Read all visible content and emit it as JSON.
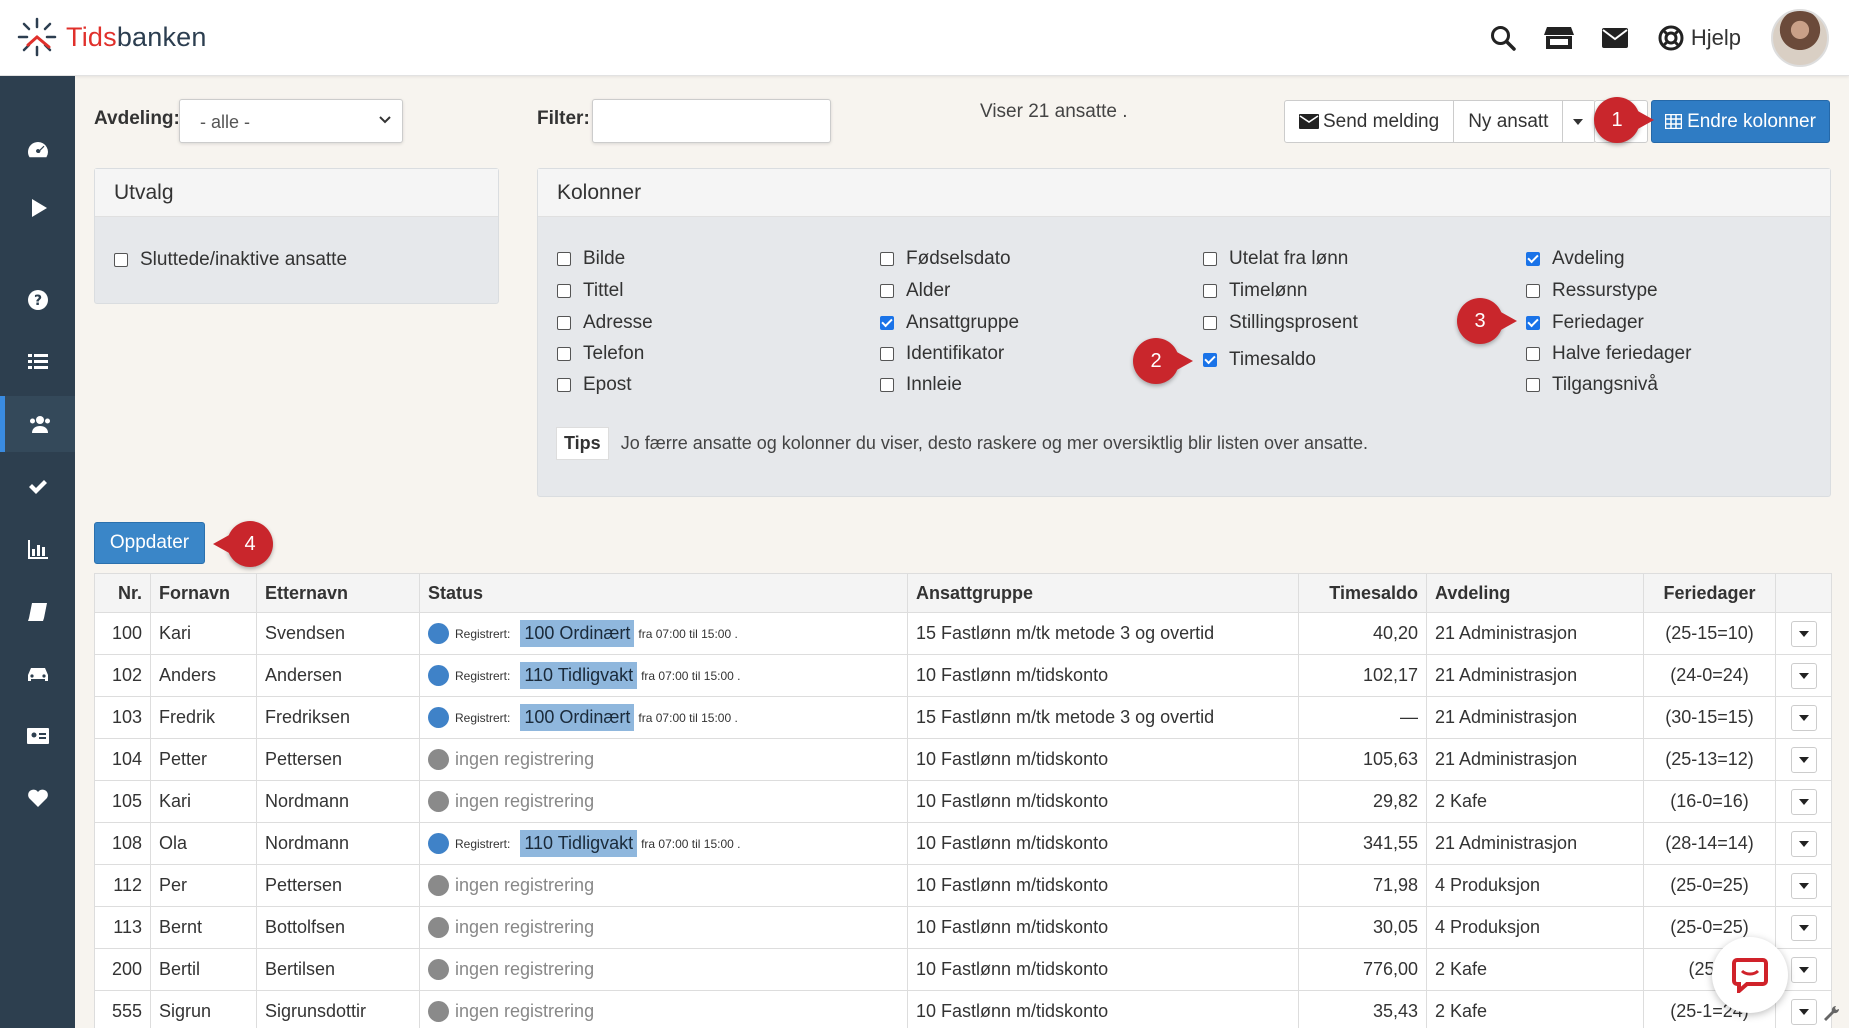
{
  "app": {
    "brand_first": "Tids",
    "brand_second": "banken"
  },
  "header": {
    "help_label": "Hjelp",
    "icons": [
      "search-icon",
      "store-icon",
      "envelope-icon",
      "lifebuoy-icon"
    ]
  },
  "sidebar": {
    "icons": [
      "dashboard-icon",
      "play-icon",
      "question-icon",
      "list-icon",
      "users-icon",
      "check-icon",
      "bar-chart-icon",
      "book-icon",
      "car-icon",
      "id-card-icon",
      "heart-icon"
    ],
    "active": "users-icon"
  },
  "toolbar": {
    "department_label": "Avdeling:",
    "department_value": "- alle -",
    "filter_label": "Filter:",
    "filter_value": "",
    "showing_text": "Viser 21 ansatte .",
    "send_message": "Send melding",
    "new_employee": "Ny ansatt",
    "change_columns": "Endre kolonner"
  },
  "selection_panel": {
    "title": "Utvalg",
    "inactive_label": "Sluttede/inaktive ansatte",
    "inactive_checked": false
  },
  "columns_panel": {
    "title": "Kolonner",
    "col1": [
      {
        "label": "Bilde",
        "checked": false
      },
      {
        "label": "Tittel",
        "checked": false
      },
      {
        "label": "Adresse",
        "checked": false
      },
      {
        "label": "Telefon",
        "checked": false
      },
      {
        "label": "Epost",
        "checked": false
      }
    ],
    "col2": [
      {
        "label": "Fødselsdato",
        "checked": false
      },
      {
        "label": "Alder",
        "checked": false
      },
      {
        "label": "Ansattgruppe",
        "checked": true
      },
      {
        "label": "Identifikator",
        "checked": false
      },
      {
        "label": "Innleie",
        "checked": false
      }
    ],
    "col3": [
      {
        "label": "Utelat fra lønn",
        "checked": false
      },
      {
        "label": "Timelønn",
        "checked": false
      },
      {
        "label": "Stillingsprosent",
        "checked": false
      },
      {
        "label": "Timesaldo",
        "checked": true
      }
    ],
    "col4": [
      {
        "label": "Avdeling",
        "checked": true
      },
      {
        "label": "Ressurstype",
        "checked": false
      },
      {
        "label": "Feriedager",
        "checked": true
      },
      {
        "label": "Halve feriedager",
        "checked": false
      },
      {
        "label": "Tilgangsnivå",
        "checked": false
      }
    ],
    "tips_badge": "Tips",
    "tips_text": "Jo færre ansatte og kolonner du viser, desto raskere og mer oversiktlig blir listen over ansatte."
  },
  "update_button": "Oppdater",
  "callouts": [
    "1",
    "2",
    "3",
    "4"
  ],
  "table": {
    "headers": [
      "Nr.",
      "Fornavn",
      "Etternavn",
      "Status",
      "Ansattgruppe",
      "Timesaldo",
      "Avdeling",
      "Feriedager"
    ],
    "registered_label": "Registrert:",
    "none_label": "ingen registrering",
    "rows": [
      {
        "nr": "100",
        "first": "Kari",
        "last": "Svendsen",
        "status": "reg",
        "shift": "100 Ordinært",
        "time": "fra 07:00 til 15:00 .",
        "group": "15 Fastlønn m/tk metode 3 og overtid",
        "balance": "40,20",
        "dept": "21 Administrasjon",
        "vacation": "(25-15=10)"
      },
      {
        "nr": "102",
        "first": "Anders",
        "last": "Andersen",
        "status": "reg",
        "shift": "110 Tidligvakt",
        "time": "fra 07:00 til 15:00 .",
        "group": "10 Fastlønn m/tidskonto",
        "balance": "102,17",
        "dept": "21 Administrasjon",
        "vacation": "(24-0=24)"
      },
      {
        "nr": "103",
        "first": "Fredrik",
        "last": "Fredriksen",
        "status": "reg",
        "shift": "100 Ordinært",
        "time": "fra 07:00 til 15:00 .",
        "group": "15 Fastlønn m/tk metode 3 og overtid",
        "balance": "—",
        "dept": "21 Administrasjon",
        "vacation": "(30-15=15)"
      },
      {
        "nr": "104",
        "first": "Petter",
        "last": "Pettersen",
        "status": "none",
        "shift": "",
        "time": "",
        "group": "10 Fastlønn m/tidskonto",
        "balance": "105,63",
        "dept": "21 Administrasjon",
        "vacation": "(25-13=12)"
      },
      {
        "nr": "105",
        "first": "Kari",
        "last": "Nordmann",
        "status": "none",
        "shift": "",
        "time": "",
        "group": "10 Fastlønn m/tidskonto",
        "balance": "29,82",
        "dept": "2 Kafe",
        "vacation": "(16-0=16)"
      },
      {
        "nr": "108",
        "first": "Ola",
        "last": "Nordmann",
        "status": "reg",
        "shift": "110 Tidligvakt",
        "time": "fra 07:00 til 15:00 .",
        "group": "10 Fastlønn m/tidskonto",
        "balance": "341,55",
        "dept": "21 Administrasjon",
        "vacation": "(28-14=14)"
      },
      {
        "nr": "112",
        "first": "Per",
        "last": "Pettersen",
        "status": "none",
        "shift": "",
        "time": "",
        "group": "10 Fastlønn m/tidskonto",
        "balance": "71,98",
        "dept": "4 Produksjon",
        "vacation": "(25-0=25)"
      },
      {
        "nr": "113",
        "first": "Bernt",
        "last": "Bottolfsen",
        "status": "none",
        "shift": "",
        "time": "",
        "group": "10 Fastlønn m/tidskonto",
        "balance": "30,05",
        "dept": "4 Produksjon",
        "vacation": "(25-0=25)"
      },
      {
        "nr": "200",
        "first": "Bertil",
        "last": "Bertilsen",
        "status": "none",
        "shift": "",
        "time": "",
        "group": "10 Fastlønn m/tidskonto",
        "balance": "776,00",
        "dept": "2 Kafe",
        "vacation": "(25-0"
      },
      {
        "nr": "555",
        "first": "Sigrun",
        "last": "Sigrunsdottir",
        "status": "none",
        "shift": "",
        "time": "",
        "group": "10 Fastlønn m/tidskonto",
        "balance": "35,43",
        "dept": "2 Kafe",
        "vacation": "(25-1=24)"
      }
    ]
  },
  "colors": {
    "primary": "#2f7cc4",
    "sidebar": "#2d3f4f",
    "callout": "#c9262c",
    "shift": "#8fb7dd",
    "logo_red": "#e0302b"
  }
}
